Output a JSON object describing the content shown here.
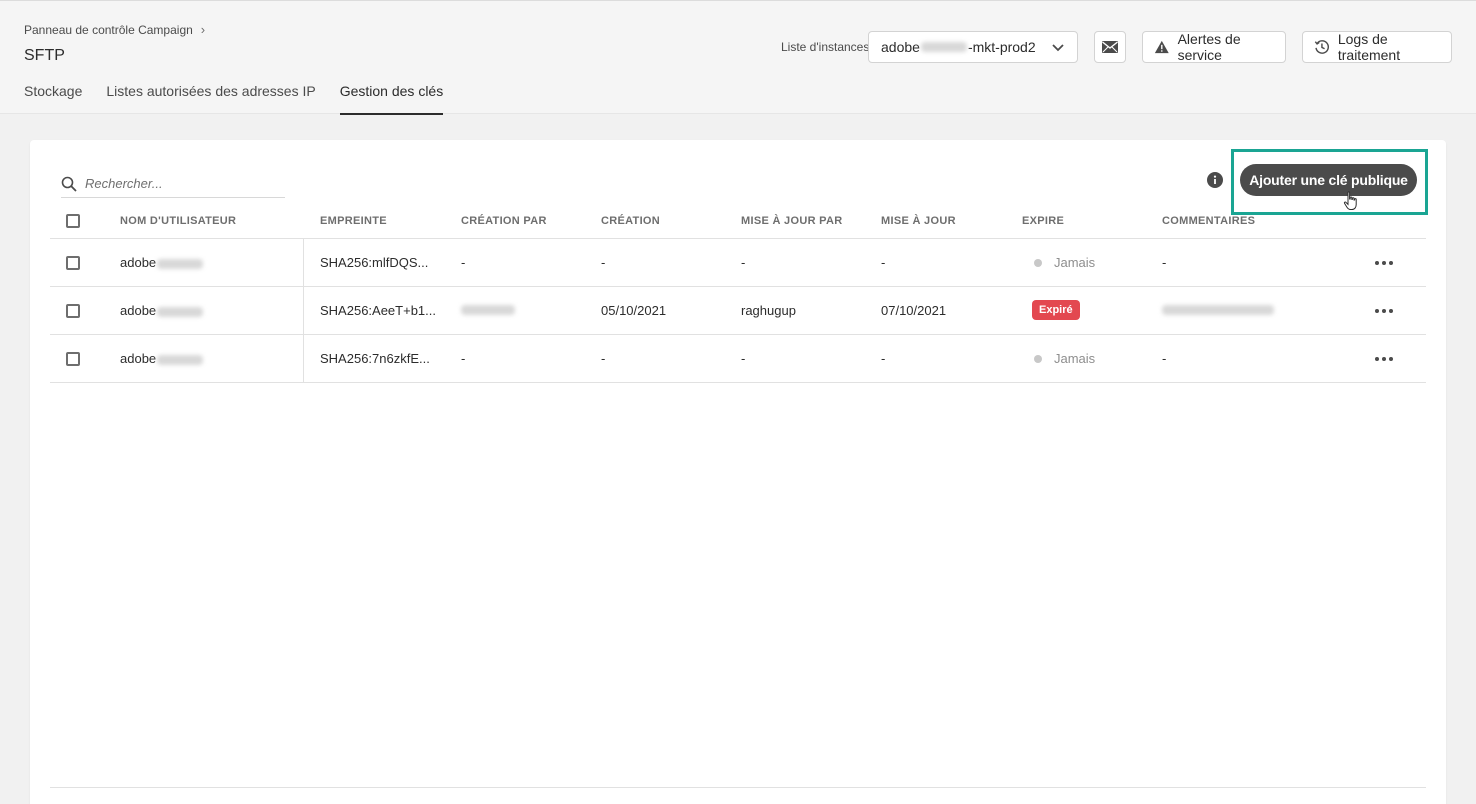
{
  "header": {
    "breadcrumb": "Panneau de contrôle Campaign",
    "title": "SFTP",
    "tabs": [
      {
        "label": "Stockage",
        "active": false
      },
      {
        "label": "Listes autorisées des adresses IP",
        "active": false
      },
      {
        "label": "Gestion des clés",
        "active": true
      }
    ],
    "instance_label": "Liste d'instances",
    "instance_value_prefix": "adobe",
    "instance_value_suffix": "-mkt-prod2",
    "alerts_label": "Alertes de service",
    "logs_label": "Logs de traitement"
  },
  "toolbar": {
    "search_placeholder": "Rechercher...",
    "add_key_label": "Ajouter une clé publique"
  },
  "table": {
    "columns": [
      "NOM D'UTILISATEUR",
      "EMPREINTE",
      "CRÉATION PAR",
      "CRÉATION",
      "MISE À JOUR PAR",
      "MISE À JOUR",
      "EXPIRE",
      "COMMENTAIRES"
    ],
    "rows": [
      {
        "user": "adobe",
        "fingerprint": "SHA256:mlfDQS...",
        "created_by": "-",
        "created": "-",
        "updated_by": "-",
        "updated": "-",
        "expires": "Jamais",
        "expired": false,
        "comments": "-"
      },
      {
        "user": "adobe",
        "fingerprint": "SHA256:AeeT+b1...",
        "created_by": "",
        "created": "05/10/2021",
        "updated_by": "raghugup",
        "updated": "07/10/2021",
        "expires": "Expiré",
        "expired": true,
        "comments": ""
      },
      {
        "user": "adobe",
        "fingerprint": "SHA256:7n6zkfE...",
        "created_by": "-",
        "created": "-",
        "updated_by": "-",
        "updated": "-",
        "expires": "Jamais",
        "expired": false,
        "comments": "-"
      }
    ]
  },
  "colors": {
    "accent_highlight": "#1aa593",
    "expired_badge": "#e34850",
    "primary_button": "#4b4b4b"
  }
}
